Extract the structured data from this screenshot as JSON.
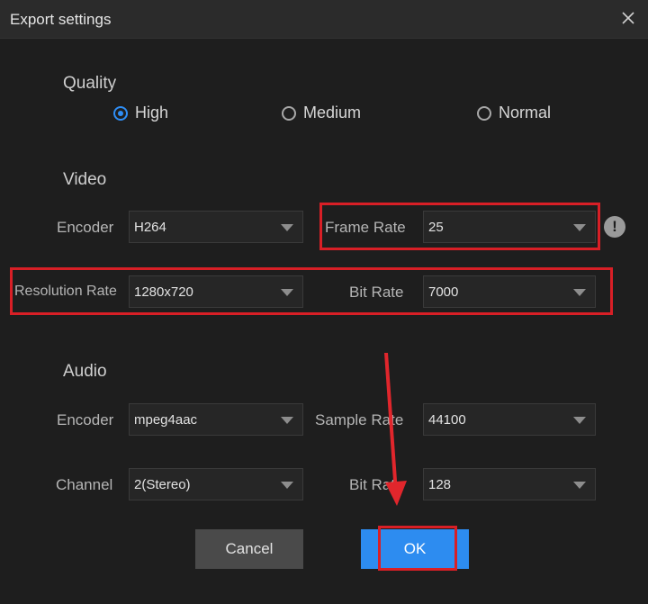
{
  "window": {
    "title": "Export settings",
    "close_icon": "close-icon"
  },
  "quality": {
    "heading": "Quality",
    "options": [
      {
        "label": "High",
        "selected": true
      },
      {
        "label": "Medium",
        "selected": false
      },
      {
        "label": "Normal",
        "selected": false
      }
    ]
  },
  "video": {
    "heading": "Video",
    "encoder_label": "Encoder",
    "encoder_value": "H264",
    "frame_rate_label": "Frame Rate",
    "frame_rate_value": "25",
    "resolution_label": "Resolution Rate",
    "resolution_value": "1280x720",
    "bit_rate_label": "Bit Rate",
    "bit_rate_value": "7000",
    "info_icon": "exclamation-icon",
    "info_glyph": "!"
  },
  "audio": {
    "heading": "Audio",
    "encoder_label": "Encoder",
    "encoder_value": "mpeg4aac",
    "sample_rate_label": "Sample Rate",
    "sample_rate_value": "44100",
    "channel_label": "Channel",
    "channel_value": "2(Stereo)",
    "bit_rate_label": "Bit Rate",
    "bit_rate_value": "128"
  },
  "buttons": {
    "cancel": "Cancel",
    "ok": "OK"
  },
  "colors": {
    "accent": "#2d8cf0",
    "highlight": "#d81f26",
    "background": "#1e1e1e"
  }
}
